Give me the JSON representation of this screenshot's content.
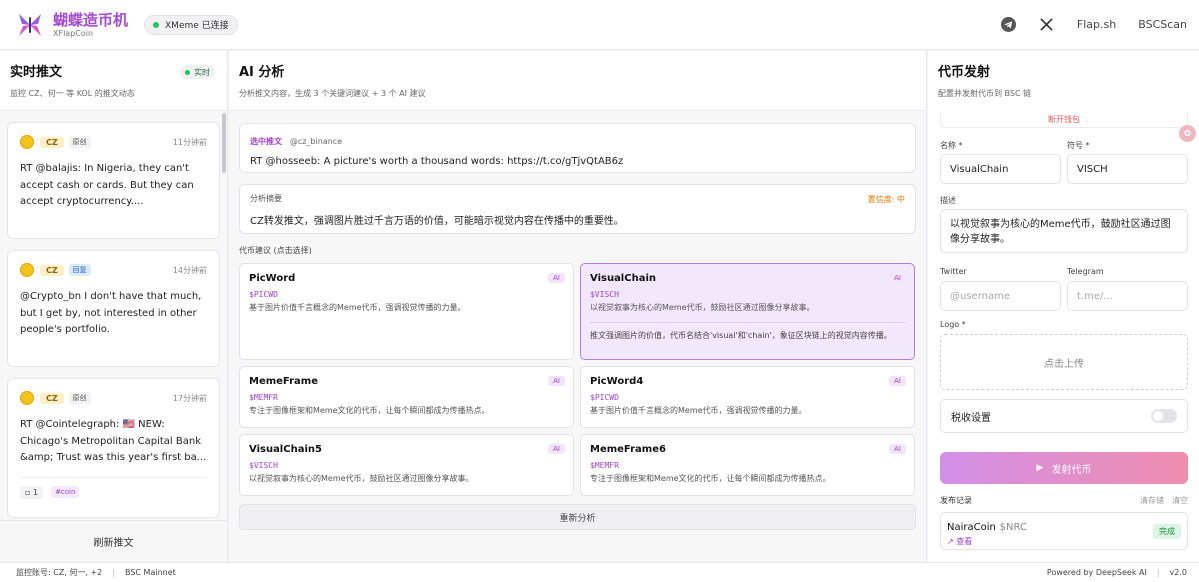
{
  "header": {
    "title": "蝴蝶造币机",
    "subtitle": "XFlapCoin",
    "connection": "XMeme 已连接",
    "links": [
      "Flap.sh",
      "BSCScan"
    ],
    "icons": [
      "telegram-icon",
      "x-icon"
    ]
  },
  "feed": {
    "title": "实时推文",
    "subtitle": "监控 CZ、何一 等 KOL 的推文动态",
    "live": "实时",
    "tweets": [
      {
        "author": "CZ",
        "type": "原创",
        "time": "11分钟前",
        "text": "RT @balajis: In Nigeria, they can't accept cash or cards. But they can accept cryptocurrency...."
      },
      {
        "author": "CZ",
        "type": "回复",
        "time": "14分钟前",
        "text": "@Crypto_bn I don't have that much, but I get by, not interested in other people's portfolio."
      },
      {
        "author": "CZ",
        "type": "原创",
        "time": "17分钟前",
        "text": "RT @Cointelegraph: 🇺🇸 NEW: Chicago's Metropolitan Capital Bank &amp; Trust was this year's first ba...",
        "count": "1",
        "tag": "#coin"
      }
    ],
    "refresh": "刷新推文"
  },
  "analysis": {
    "title": "AI 分析",
    "subtitle": "分析推文内容，生成 3 个关键词建议 + 3 个 AI 建议",
    "selected_label": "选中推文",
    "selected_handle": "@cz_binance",
    "selected_text": "RT @hosseeb: A picture's worth a thousand words: https://t.co/gTjvQtAB6z",
    "summary_label": "分析摘要",
    "confidence": "置信度: 中",
    "summary_text": "CZ转发推文，强调图片胜过千言万语的价值，可能暗示视觉内容在传播中的重要性。",
    "suggestions_label": "代币建议 (点击选择)",
    "suggestions": [
      {
        "name": "PicWord",
        "symbol": "$PICWD",
        "desc": "基于图片价值千言概念的Meme代币，强调视觉传播的力量。",
        "tag": "AI"
      },
      {
        "name": "VisualChain",
        "symbol": "$VISCH",
        "desc": "以视觉叙事为核心的Meme代币，鼓励社区通过图像分享故事。",
        "tag": "AI",
        "reason": "推文强调图片的价值，代币名结合'visual'和'chain'，象征区块链上的视觉内容传播。"
      },
      {
        "name": "MemeFrame",
        "symbol": "$MEMFR",
        "desc": "专注于图像框架和Meme文化的代币，让每个瞬间都成为传播热点。",
        "tag": "AI"
      },
      {
        "name": "PicWord4",
        "symbol": "$PICWD",
        "desc": "基于图片价值千言概念的Meme代币，强调视觉传播的力量。",
        "tag": "AI"
      },
      {
        "name": "VisualChain5",
        "symbol": "$VISCH",
        "desc": "以视觉叙事为核心的Meme代币，鼓励社区通过图像分享故事。",
        "tag": "AI"
      },
      {
        "name": "MemeFrame6",
        "symbol": "$MEMFR",
        "desc": "专注于图像框架和Meme文化的代币，让每个瞬间都成为传播热点。",
        "tag": "AI"
      }
    ],
    "reanalyze": "重新分析"
  },
  "launch": {
    "title": "代币发射",
    "subtitle": "配置并发射代币到 BSC 链",
    "cut_text": "断开钱包",
    "name_label": "名称 *",
    "name_value": "VisualChain",
    "symbol_label": "符号 *",
    "symbol_value": "VISCH",
    "desc_label": "描述",
    "desc_value": "以视觉叙事为核心的Meme代币，鼓励社区通过图像分享故事。",
    "twitter_label": "Twitter",
    "twitter_placeholder": "@username",
    "telegram_label": "Telegram",
    "telegram_placeholder": "t.me/...",
    "logo_label": "Logo *",
    "upload_text": "点击上传",
    "tax_label": "税收设置",
    "launch_button": "发射代币",
    "history_label": "发布记录",
    "history_clear_cache": "清存储",
    "history_clear": "清空",
    "history": [
      {
        "name": "NairaCoin",
        "symbol": "$NRC",
        "view": "查看",
        "status": "完成"
      }
    ]
  },
  "footer": {
    "accounts": "监控账号: CZ, 何一, +2",
    "network": "BSC Mainnet",
    "powered": "Powered by DeepSeek AI",
    "version": "v2.0"
  },
  "colors": {
    "accent": "#a13fd1",
    "live": "#22c55e",
    "confidence": "#e07a00"
  }
}
